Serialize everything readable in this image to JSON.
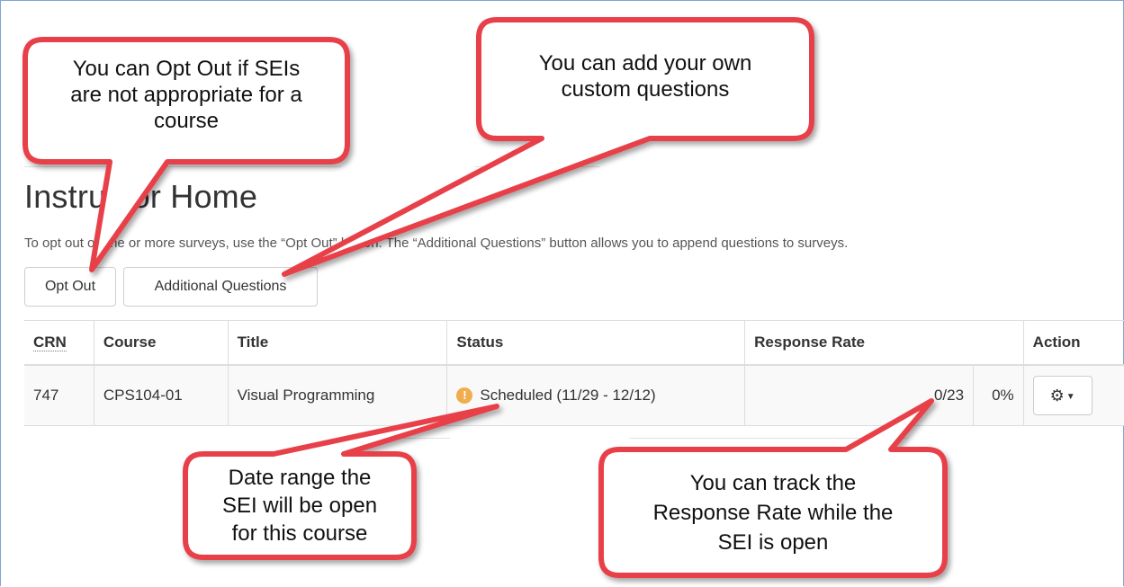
{
  "page": {
    "title": "Instructor Home",
    "intro": "To opt out of one or more surveys, use the “Opt Out” button. The “Additional Questions” button allows you to append questions to surveys."
  },
  "buttons": {
    "opt_out": "Opt Out",
    "additional_questions": "Additional Questions"
  },
  "table": {
    "headers": {
      "crn": "CRN",
      "course": "Course",
      "title": "Title",
      "status": "Status",
      "response_rate": "Response Rate",
      "action": "Action"
    },
    "rows": [
      {
        "crn": "747",
        "course": "CPS104-01",
        "title": "Visual Programming",
        "status": "Scheduled (11/29 - 12/12)",
        "status_icon": "exclamation-circle-icon",
        "responses": "0/23",
        "percent": "0%",
        "action_icon": "gear-icon"
      }
    ]
  },
  "callouts": {
    "opt_out": [
      "You can Opt Out if SEIs",
      "are not appropriate for a",
      "course"
    ],
    "custom_questions": [
      "You can add your own",
      "custom questions"
    ],
    "date_range": [
      "Date range the",
      "SEI will be open",
      "for this course"
    ],
    "response_rate": [
      "You can track the",
      "Response Rate while the",
      "SEI is open"
    ]
  },
  "colors": {
    "callout_border": "#e8404a",
    "status_warning": "#f0ad4e",
    "frame_border": "#7fa6cf"
  }
}
